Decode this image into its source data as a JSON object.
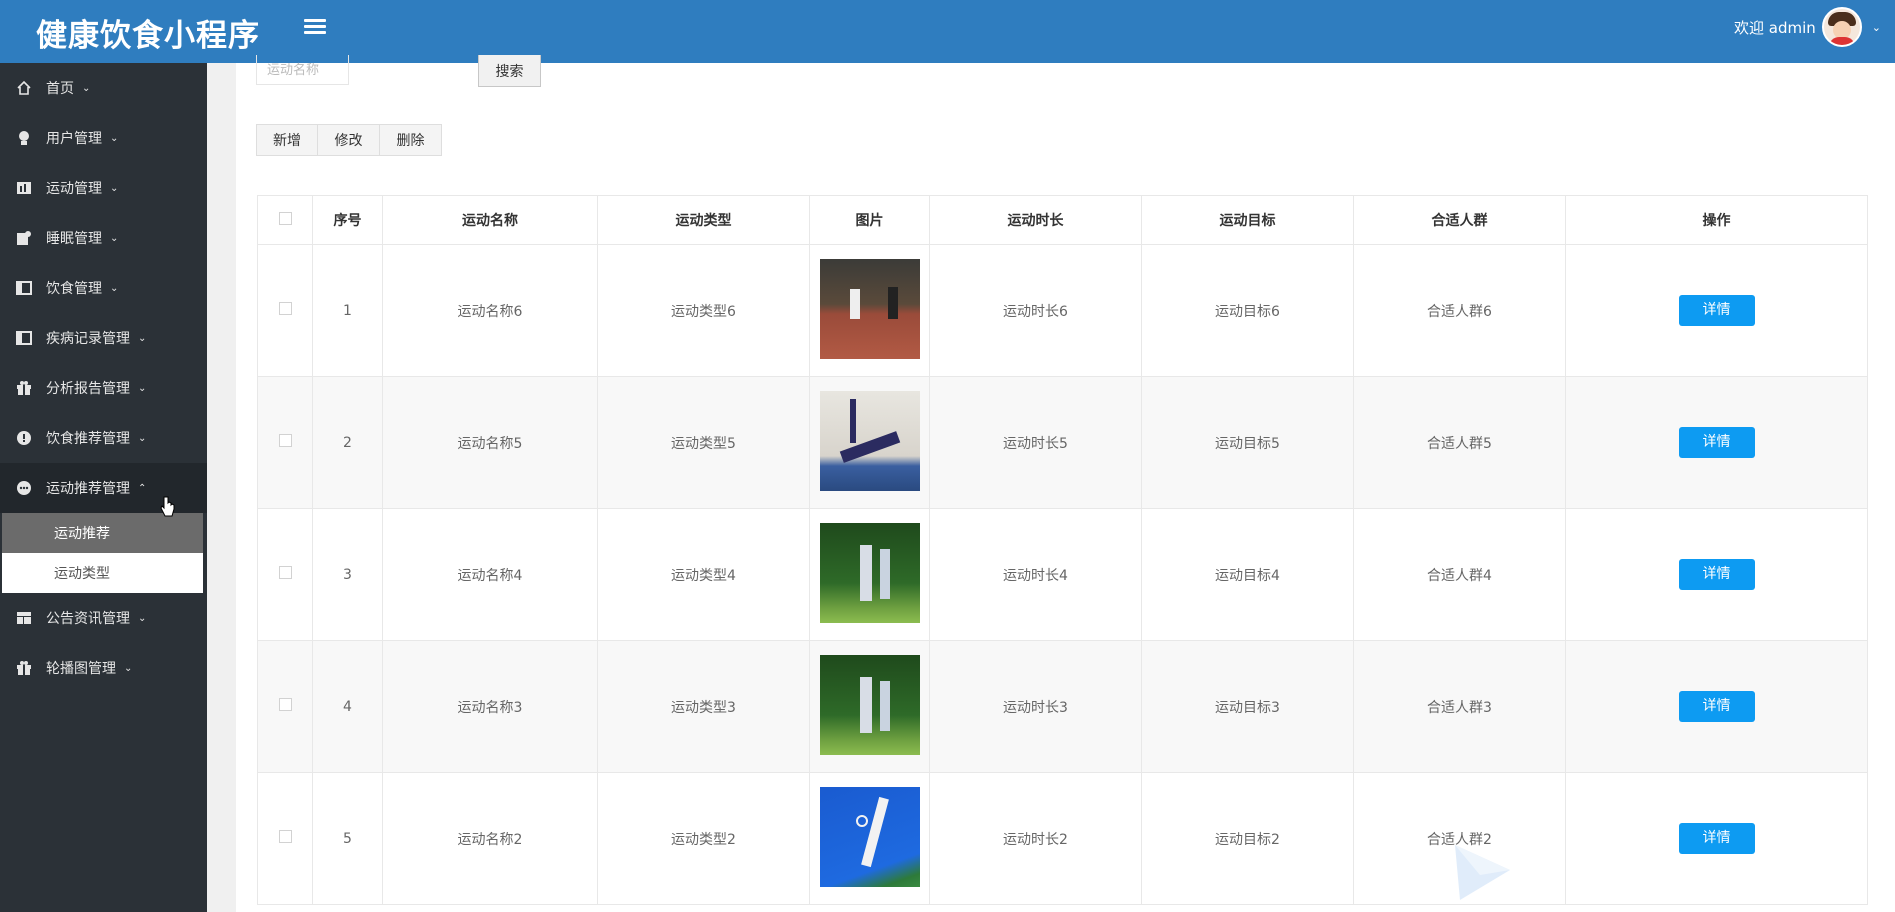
{
  "header": {
    "brand": "健康饮食小程序",
    "welcome": "欢迎 admin"
  },
  "sidebar": {
    "items": [
      {
        "label": "首页",
        "icon": "home-icon"
      },
      {
        "label": "用户管理",
        "icon": "user-icon"
      },
      {
        "label": "运动管理",
        "icon": "chart-icon"
      },
      {
        "label": "睡眠管理",
        "icon": "profile-icon"
      },
      {
        "label": "饮食管理",
        "icon": "panel-icon"
      },
      {
        "label": "疾病记录管理",
        "icon": "panel-icon"
      },
      {
        "label": "分析报告管理",
        "icon": "gift-icon"
      },
      {
        "label": "饮食推荐管理",
        "icon": "info-icon"
      },
      {
        "label": "运动推荐管理",
        "icon": "more-icon"
      },
      {
        "label": "公告资讯管理",
        "icon": "layout-icon"
      },
      {
        "label": "轮播图管理",
        "icon": "gift-icon"
      }
    ],
    "submenu": [
      {
        "label": "运动推荐"
      },
      {
        "label": "运动类型"
      }
    ]
  },
  "toolbar": {
    "search_placeholder": "运动名称",
    "search_label": "搜索",
    "add_label": "新增",
    "edit_label": "修改",
    "delete_label": "删除"
  },
  "table": {
    "headers": [
      "序号",
      "运动名称",
      "运动类型",
      "图片",
      "运动时长",
      "运动目标",
      "合适人群",
      "操作"
    ],
    "rows": [
      {
        "index": "1",
        "name": "运动名称6",
        "type": "运动类型6",
        "duration": "运动时长6",
        "goal": "运动目标6",
        "crowd": "合适人群6",
        "action": "详情"
      },
      {
        "index": "2",
        "name": "运动名称5",
        "type": "运动类型5",
        "duration": "运动时长5",
        "goal": "运动目标5",
        "crowd": "合适人群5",
        "action": "详情"
      },
      {
        "index": "3",
        "name": "运动名称4",
        "type": "运动类型4",
        "duration": "运动时长4",
        "goal": "运动目标4",
        "crowd": "合适人群4",
        "action": "详情"
      },
      {
        "index": "4",
        "name": "运动名称3",
        "type": "运动类型3",
        "duration": "运动时长3",
        "goal": "运动目标3",
        "crowd": "合适人群3",
        "action": "详情"
      },
      {
        "index": "5",
        "name": "运动名称2",
        "type": "运动类型2",
        "duration": "运动时长2",
        "goal": "运动目标2",
        "crowd": "合适人群2",
        "action": "详情"
      }
    ]
  },
  "colors": {
    "header": "#2f7dbf",
    "sidebar": "#2b3137",
    "primary_button": "#0d9bf2"
  }
}
